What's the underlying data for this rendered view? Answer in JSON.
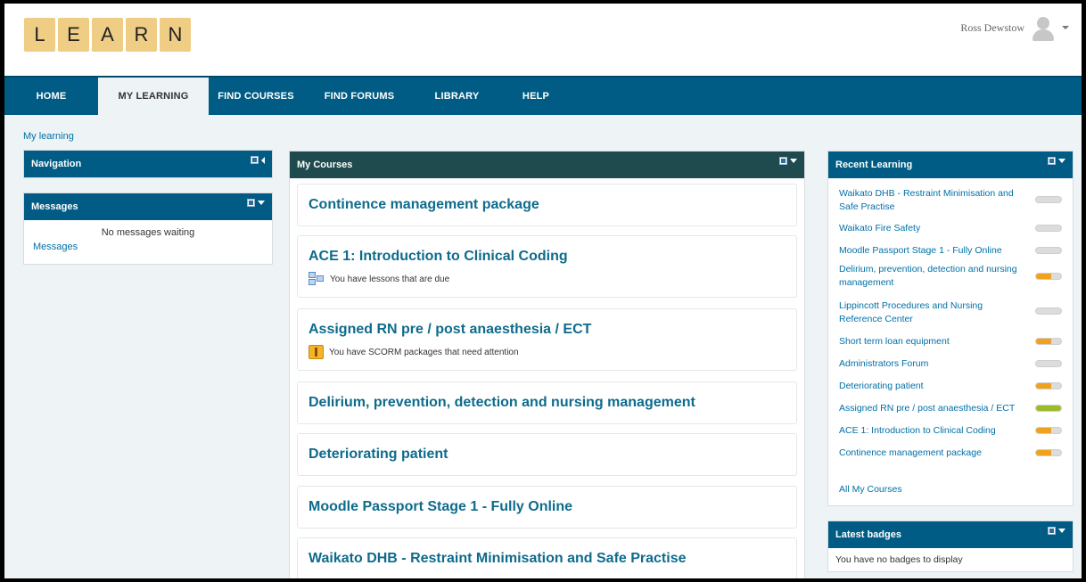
{
  "logo": {
    "letters": [
      "L",
      "E",
      "A",
      "R",
      "N"
    ]
  },
  "user": {
    "name": "Ross Dewstow"
  },
  "nav": {
    "items": [
      {
        "label": "HOME"
      },
      {
        "label": "MY LEARNING",
        "active": true
      },
      {
        "label": "FIND COURSES"
      },
      {
        "label": "FIND FORUMS"
      },
      {
        "label": "LIBRARY"
      },
      {
        "label": "HELP"
      }
    ]
  },
  "breadcrumb": "My learning",
  "navigation_block": {
    "title": "Navigation"
  },
  "messages_block": {
    "title": "Messages",
    "empty_text": "No messages waiting",
    "link": "Messages"
  },
  "my_courses": {
    "title": "My Courses",
    "courses": [
      {
        "title": "Continence management package"
      },
      {
        "title": "ACE 1: Introduction to Clinical Coding",
        "note": "You have lessons that are due",
        "icon": "lesson-icon"
      },
      {
        "title": "Assigned RN pre / post anaesthesia / ECT",
        "note": "You have SCORM packages that need attention",
        "icon": "scorm-icon"
      },
      {
        "title": "Delirium, prevention, detection and nursing management"
      },
      {
        "title": "Deteriorating patient"
      },
      {
        "title": "Moodle Passport Stage 1 - Fully Online"
      },
      {
        "title": "Waikato DHB - Restraint Minimisation and Safe Practise"
      }
    ]
  },
  "recent_learning": {
    "title": "Recent Learning",
    "items": [
      {
        "label": "Waikato DHB - Restraint Minimisation and Safe Practise",
        "progress": 0,
        "color": "#dcdcdc"
      },
      {
        "label": "Waikato Fire Safety",
        "progress": 0,
        "color": "#dcdcdc"
      },
      {
        "label": "Moodle Passport Stage 1 - Fully Online",
        "progress": 0,
        "color": "#dcdcdc"
      },
      {
        "label": "Delirium, prevention, detection and nursing management",
        "progress": 0.6,
        "color": "#f0a21e"
      },
      {
        "label": "Lippincott Procedures and Nursing Reference Center",
        "progress": 0,
        "color": "#dcdcdc"
      },
      {
        "label": "Short term loan equipment",
        "progress": 0.6,
        "color": "#f0a21e"
      },
      {
        "label": "Administrators Forum",
        "progress": 0,
        "color": "#dcdcdc"
      },
      {
        "label": "Deteriorating patient",
        "progress": 0.6,
        "color": "#f0a21e"
      },
      {
        "label": "Assigned RN pre / post anaesthesia / ECT",
        "progress": 1,
        "color": "#9bbb2a"
      },
      {
        "label": "ACE 1: Introduction to Clinical Coding",
        "progress": 0.6,
        "color": "#f0a21e"
      },
      {
        "label": "Continence management package",
        "progress": 0.6,
        "color": "#f0a21e"
      }
    ],
    "all_link": "All My Courses"
  },
  "latest_badges": {
    "title": "Latest badges",
    "empty_text": "You have no badges to display"
  },
  "colors": {
    "nav_bg": "#005c84",
    "courses_head": "#1f4a4e",
    "link": "#0070a8",
    "logo_tile": "#f0cd85"
  }
}
